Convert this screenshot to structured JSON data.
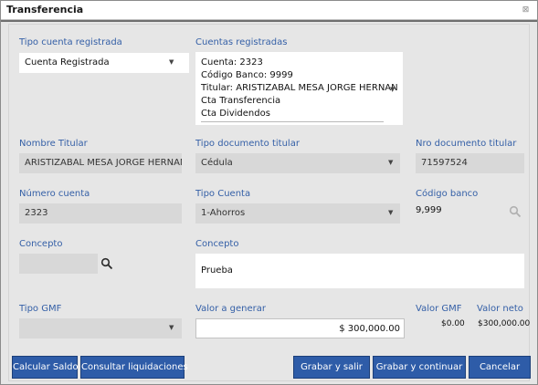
{
  "window": {
    "title": "Transferencia",
    "close": "⊠"
  },
  "tipo_cuenta": {
    "label": "Tipo cuenta registrada",
    "value": "Cuenta Registrada"
  },
  "cuentas": {
    "label": "Cuentas registradas",
    "lines": [
      "Cuenta: 2323",
      "Código Banco: 9999",
      "Titular: ARISTIZABAL MESA JORGE HERNAN",
      "Cta Transferencia",
      "Cta Dividendos"
    ]
  },
  "nombre_titular": {
    "label": "Nombre Titular",
    "value": "ARISTIZABAL MESA JORGE HERNAN"
  },
  "tipo_documento": {
    "label": "Tipo documento titular",
    "value": "Cédula"
  },
  "nro_documento": {
    "label": "Nro documento titular",
    "value": "71597524"
  },
  "numero_cuenta": {
    "label": "Número cuenta",
    "value": "2323"
  },
  "tipo_cuenta_2": {
    "label": "Tipo Cuenta",
    "value": "1-Ahorros"
  },
  "codigo_banco": {
    "label": "Código banco",
    "value": "9,999"
  },
  "concepto_left": {
    "label": "Concepto",
    "value": ""
  },
  "concepto": {
    "label": "Concepto",
    "value": "Prueba"
  },
  "tipo_gmf": {
    "label": "Tipo GMF",
    "value": ""
  },
  "valor_generar": {
    "label": "Valor a generar",
    "value": "$ 300,000.00"
  },
  "valor_gmf": {
    "label": "Valor GMF",
    "value": "$0.00"
  },
  "valor_neto": {
    "label": "Valor neto",
    "value": "$300,000.00"
  },
  "buttons": {
    "calcular": "Calcular Saldo",
    "consultar": "Consultar liquidaciones",
    "grabar_salir": "Grabar y salir",
    "grabar_continuar": "Grabar y continuar",
    "cancelar": "Cancelar"
  },
  "colors": {
    "accent": "#2e5ca8",
    "label": "#3560a7",
    "background": "#e6e6e6"
  }
}
